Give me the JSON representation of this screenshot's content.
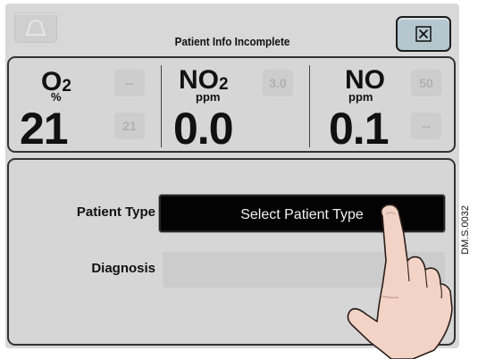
{
  "header": {
    "title": "Patient Info Incomplete",
    "bell_icon": "bell-icon",
    "close_icon": "close-icon"
  },
  "readouts": [
    {
      "name_main": "O",
      "name_sub": "2",
      "unit": "%",
      "value": "21",
      "box_top": "--",
      "box_bottom": "21"
    },
    {
      "name_main": "NO",
      "name_sub": "2",
      "unit": "ppm",
      "value": "0.0",
      "box_top": "3.0",
      "box_bottom": ""
    },
    {
      "name_main": "NO",
      "name_sub": "",
      "unit": "ppm",
      "value": "0.1",
      "box_top": "50",
      "box_bottom": "--"
    }
  ],
  "form": {
    "patient_type_label": "Patient Type",
    "patient_type_button": "Select Patient Type",
    "diagnosis_label": "Diagnosis",
    "diagnosis_value": ""
  },
  "reference_code": "DM.S.0032",
  "colors": {
    "screen_bg": "#d8d8d8",
    "close_button": "#b5c6cf",
    "select_button": "#030303",
    "hand_skin": "#f3d3c6"
  }
}
